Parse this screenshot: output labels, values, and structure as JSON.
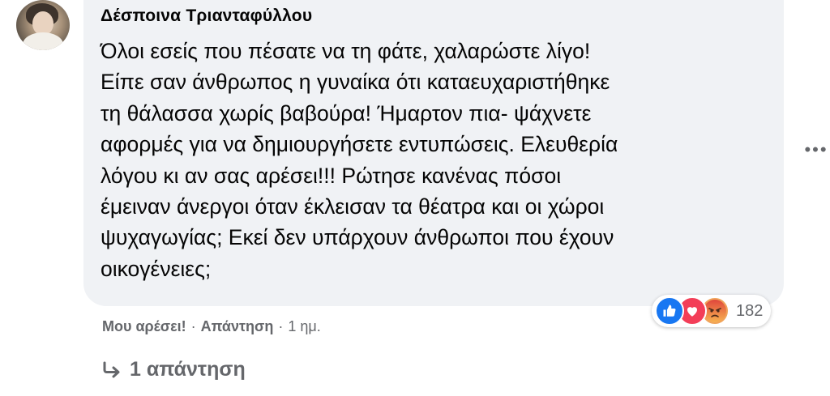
{
  "comment": {
    "author": "Δέσποινα Τριανταφύλλου",
    "text_lines": [
      "Όλοι εσείς που πέσατε να τη φάτε, χαλαρώστε λίγο!",
      "Είπε σαν άνθρωπος η γυναίκα ότι καταευχαριστήθηκε",
      "τη θάλασσα χωρίς βαβούρα! Ήμαρτον πια- ψάχνετε",
      "αφορμές για να δημιουργήσετε εντυπώσεις. Ελευθερία",
      "λόγου κι αν σας αρέσει!!! Ρώτησε κανένας πόσοι",
      "έμειναν άνεργοι όταν έκλεισαν τα θέατρα και οι χώροι",
      "ψυχαγωγίας; Εκεί δεν υπάρχουν άνθρωποι που έχουν",
      "οικογένειες;"
    ]
  },
  "actions": {
    "like_label": "Μου αρέσει!",
    "separator": "·",
    "reply_label": "Απάντηση",
    "timestamp": "1 ημ."
  },
  "reactions": {
    "icons": [
      "like-icon",
      "love-icon",
      "angry-icon"
    ],
    "count": "182"
  },
  "replies": {
    "label": "1 απάντηση",
    "icon": "reply-arrow-icon"
  },
  "colors": {
    "bubble_bg": "#f0f2f5",
    "text": "#050505",
    "secondary_text": "#65676b",
    "like_blue": "#1877f2",
    "love_red": "#f33e58",
    "angry_orange": "#f0a35a"
  }
}
